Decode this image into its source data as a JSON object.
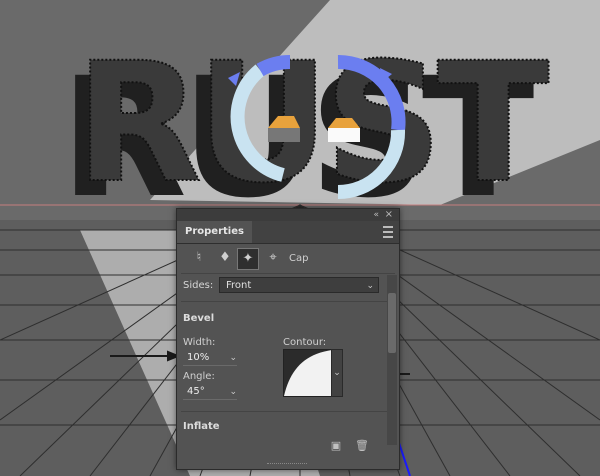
{
  "title": "RUST",
  "panel": {
    "tab": "Properties",
    "collapse": "«",
    "close": "×",
    "menu": "panel-menu-icon",
    "tools": [
      "mesh-icon",
      "deform-icon",
      "cap-icon",
      "coordinates-icon"
    ],
    "cap_label": "Cap",
    "sides_label": "Sides:",
    "sides_value": "Front",
    "bevel_title": "Bevel",
    "width_label": "Width:",
    "width_value": "10%",
    "contour_label": "Contour:",
    "angle_label": "Angle:",
    "angle_value": "45°",
    "inflate_title": "Inflate"
  },
  "colors": {
    "panel_bg": "#535353",
    "floor": "#505050",
    "text_dark": "#222222",
    "ring": "#c9e3f1",
    "ring_accent": "#6b7ef0",
    "widget": "#e8a23c"
  }
}
